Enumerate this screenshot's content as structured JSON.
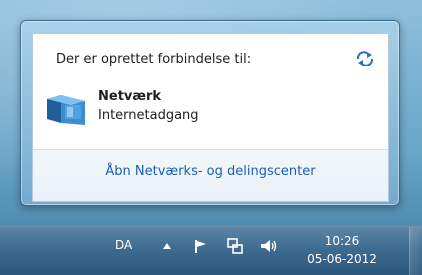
{
  "popup": {
    "header": "Der er oprettet forbindelse til:",
    "network_name": "Netværk",
    "network_status": "Internetadgang",
    "footer_link": "Åbn Netværks- og delingscenter",
    "link_color": "#1c5fb0"
  },
  "taskbar": {
    "language": "DA",
    "clock_time": "10:26",
    "clock_date": "05-06-2012",
    "tray_icons": [
      "chevron-up-icon",
      "flag-icon",
      "network-icon",
      "speaker-icon"
    ]
  },
  "colors": {
    "taskbar": "#3e6b8f",
    "popup_bg": "#ffffff"
  }
}
